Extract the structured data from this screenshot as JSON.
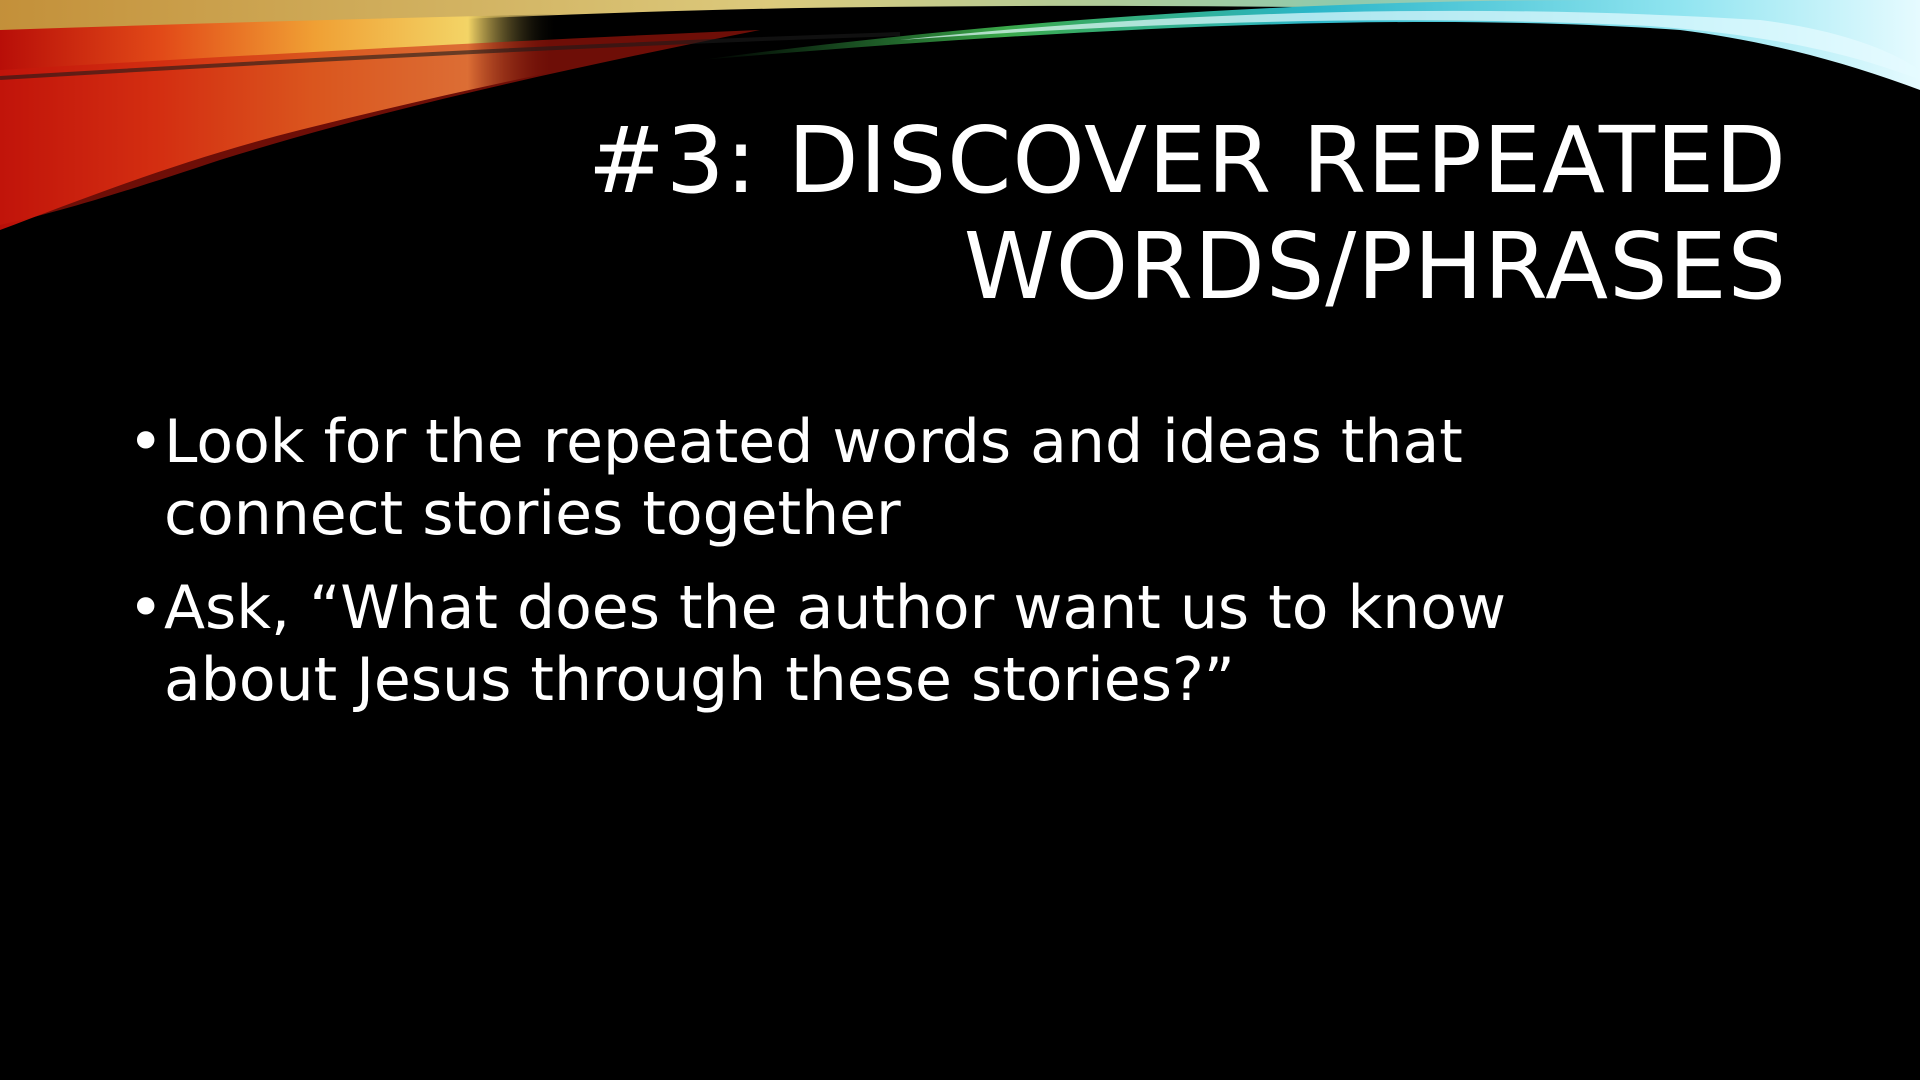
{
  "slide": {
    "title_lines": [
      "#3: DISCOVER REPEATED",
      "WORDS/PHRASES"
    ],
    "bullets": [
      {
        "lines": [
          "Look for the repeated words and ideas that",
          "connect stories together"
        ]
      },
      {
        "lines": [
          "Ask, “What does the author want us to know",
          "about Jesus through these stories?”"
        ]
      }
    ],
    "bullet_glyph": "•"
  },
  "colors": {
    "background": "#000000",
    "text": "#ffffff",
    "swoosh_warm": [
      "#c0140a",
      "#e8501a",
      "#f2a23a",
      "#f6d36a"
    ],
    "swoosh_cool": [
      "#3aa84a",
      "#2bb6c8",
      "#7fe0ee",
      "#d8f6fb"
    ]
  }
}
